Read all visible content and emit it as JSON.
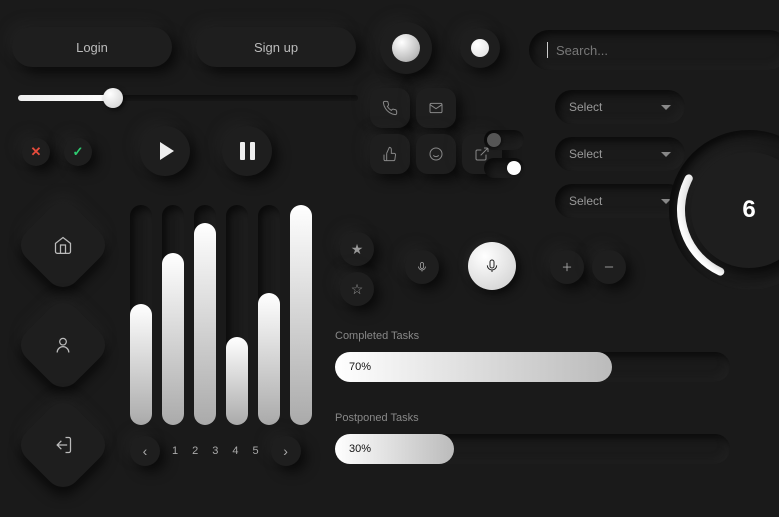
{
  "top": {
    "login": "Login",
    "signup": "Sign up"
  },
  "search": {
    "placeholder": "Search..."
  },
  "slider": {
    "value": 28
  },
  "toggles": {
    "top": false,
    "bottom": true
  },
  "selects": {
    "label": "Select"
  },
  "dial": {
    "value": "6"
  },
  "progress": {
    "completed": {
      "label": "Completed Tasks",
      "pct": 70,
      "text": "70%"
    },
    "postponed": {
      "label": "Postponed Tasks",
      "pct": 30,
      "text": "30%"
    }
  },
  "pagination": {
    "pages": [
      "1",
      "2",
      "3",
      "4",
      "5"
    ]
  },
  "eq": [
    55,
    78,
    92,
    40,
    60,
    100
  ],
  "icons": {
    "phone": "phone-icon",
    "mail": "mail-icon",
    "like": "like-icon",
    "emoji": "emoji-icon",
    "share": "share-icon"
  }
}
